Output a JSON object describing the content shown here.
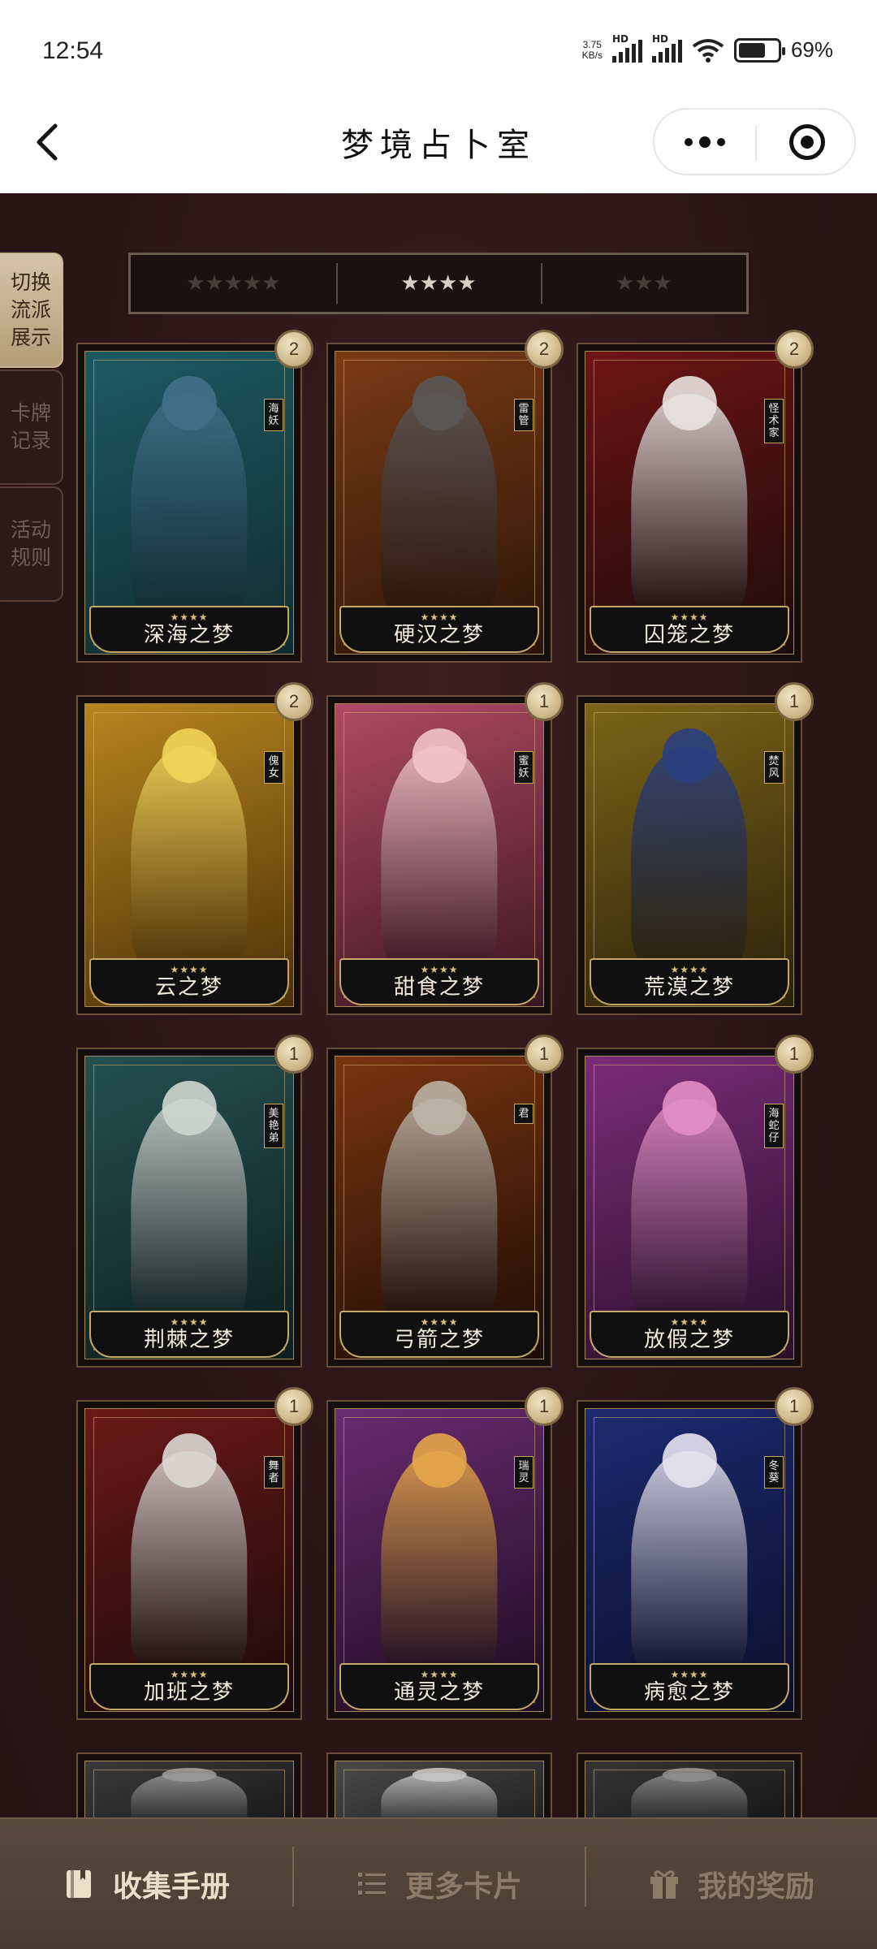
{
  "status_bar": {
    "time": "12:54",
    "net_speed_value": "3.75",
    "net_speed_unit": "KB/s",
    "signal1_label": "HD",
    "signal2_label": "HD",
    "battery_percent": "69%",
    "battery_level": 0.69
  },
  "header": {
    "title": "梦境占卜室"
  },
  "side_tabs": [
    {
      "label": "切换流派展示",
      "active": true
    },
    {
      "label": "卡牌记录",
      "active": false
    },
    {
      "label": "活动规则",
      "active": false
    }
  ],
  "star_filter": [
    {
      "label": "★★★★★",
      "active": false
    },
    {
      "label": "★★★★",
      "active": true
    },
    {
      "label": "★★★",
      "active": false
    }
  ],
  "cards": [
    {
      "name": "深海之梦",
      "count": "2",
      "tag": "海妖",
      "stars": "★★★★",
      "colors": [
        "#1d5a62",
        "#0f2b30",
        "#41718a"
      ]
    },
    {
      "name": "硬汉之梦",
      "count": "2",
      "tag": "雷管",
      "stars": "★★★★",
      "colors": [
        "#7a3a15",
        "#2a1409",
        "#5a5656"
      ]
    },
    {
      "name": "囚笼之梦",
      "count": "2",
      "tag": "怪术家",
      "stars": "★★★★",
      "colors": [
        "#6d1414",
        "#1c0b0b",
        "#e8e2e0"
      ]
    },
    {
      "name": "云之梦",
      "count": "2",
      "tag": "傀女",
      "stars": "★★★★",
      "colors": [
        "#b8861e",
        "#4b3008",
        "#f3d35a"
      ]
    },
    {
      "name": "甜食之梦",
      "count": "1",
      "tag": "蜜妖",
      "stars": "★★★★",
      "colors": [
        "#b04a64",
        "#3a1420",
        "#f1c3cb"
      ]
    },
    {
      "name": "荒漠之梦",
      "count": "1",
      "tag": "焚风",
      "stars": "★★★★",
      "colors": [
        "#7b6418",
        "#2a210a",
        "#2a3f80"
      ]
    },
    {
      "name": "荆棘之梦",
      "count": "1",
      "tag": "美艳弟",
      "stars": "★★★★",
      "colors": [
        "#245050",
        "#0d1f1f",
        "#cfd5cf"
      ]
    },
    {
      "name": "弓箭之梦",
      "count": "1",
      "tag": "君",
      "stars": "★★★★",
      "colors": [
        "#7a3410",
        "#1d0c06",
        "#bdb4a6"
      ]
    },
    {
      "name": "放假之梦",
      "count": "1",
      "tag": "海蛇仔",
      "stars": "★★★★",
      "colors": [
        "#7c2c78",
        "#2a0f2a",
        "#e38fc7"
      ]
    },
    {
      "name": "加班之梦",
      "count": "1",
      "tag": "舞者",
      "stars": "★★★★",
      "colors": [
        "#6b1818",
        "#1a0a0a",
        "#dcd7d2"
      ]
    },
    {
      "name": "通灵之梦",
      "count": "1",
      "tag": "瑞灵",
      "stars": "★★★★",
      "colors": [
        "#6a2a70",
        "#1c0c20",
        "#e6a54a"
      ]
    },
    {
      "name": "病愈之梦",
      "count": "1",
      "tag": "冬葵",
      "stars": "★★★★",
      "colors": [
        "#1c2a70",
        "#0a0f2a",
        "#e6e2f0"
      ]
    }
  ],
  "partial_cards": [
    {
      "colors": [
        "#3a3a3a",
        "#151515",
        "#9a9a9a"
      ]
    },
    {
      "colors": [
        "#4a4a4a",
        "#1a1a1a",
        "#c4c4c4"
      ]
    },
    {
      "colors": [
        "#353535",
        "#121212",
        "#8e8e8e"
      ]
    }
  ],
  "bottom_nav": [
    {
      "label": "收集手册",
      "icon": "book-icon",
      "active": true
    },
    {
      "label": "更多卡片",
      "icon": "list-icon",
      "active": false
    },
    {
      "label": "我的奖励",
      "icon": "gift-icon",
      "active": false
    }
  ]
}
